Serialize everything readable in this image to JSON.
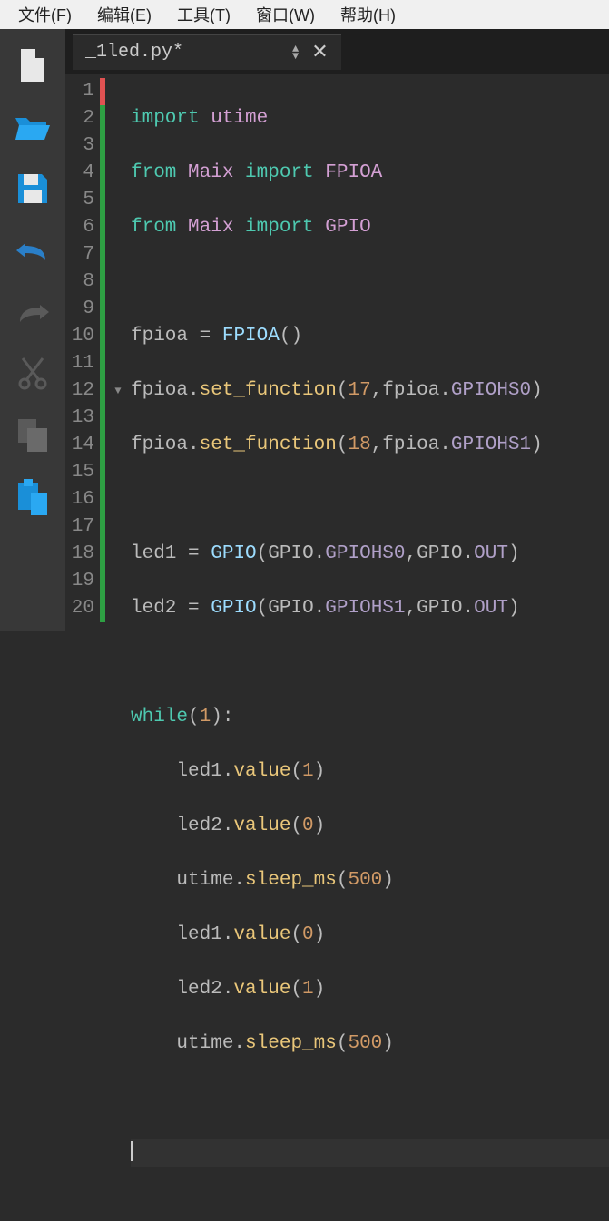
{
  "menubar": {
    "file": "文件(F)",
    "edit": "编辑(E)",
    "tools": "工具(T)",
    "window": "窗口(W)",
    "help": "帮助(H)"
  },
  "tab": {
    "title": "_1led.py*",
    "close": "✕"
  },
  "lines": [
    "1",
    "2",
    "3",
    "4",
    "5",
    "6",
    "7",
    "8",
    "9",
    "10",
    "11",
    "12",
    "13",
    "14",
    "15",
    "16",
    "17",
    "18",
    "19",
    "20"
  ],
  "code": {
    "l1": {
      "a": "import",
      "b": " utime"
    },
    "l2": {
      "a": "from",
      "b": " Maix ",
      "c": "import",
      "d": " FPIOA"
    },
    "l3": {
      "a": "from",
      "b": " Maix ",
      "c": "import",
      "d": " GPIO"
    },
    "l5": {
      "a": "fpioa ",
      "eq": "=",
      "sp": " ",
      "cls": "FPIOA",
      "p": "()"
    },
    "l6": {
      "a": "fpioa.",
      "fn": "set_function",
      "p1": "(",
      "n1": "17",
      "c": ",",
      "b": "fpioa.",
      "prop": "GPIOHS0",
      "p2": ")"
    },
    "l7": {
      "a": "fpioa.",
      "fn": "set_function",
      "p1": "(",
      "n1": "18",
      "c": ",",
      "b": "fpioa.",
      "prop": "GPIOHS1",
      "p2": ")"
    },
    "l9": {
      "a": "led1 ",
      "eq": "=",
      "sp": " ",
      "cls": "GPIO",
      "p1": "(",
      "b": "GPIO.",
      "prop1": "GPIOHS0",
      "c": ",",
      "d": "GPIO.",
      "prop2": "OUT",
      "p2": ")"
    },
    "l10": {
      "a": "led2 ",
      "eq": "=",
      "sp": " ",
      "cls": "GPIO",
      "p1": "(",
      "b": "GPIO.",
      "prop1": "GPIOHS1",
      "c": ",",
      "d": "GPIO.",
      "prop2": "OUT",
      "p2": ")"
    },
    "l12": {
      "kw": "while",
      "p1": "(",
      "n": "1",
      "p2": "):"
    },
    "l13": {
      "a": "    led1.",
      "fn": "value",
      "p1": "(",
      "n": "1",
      "p2": ")"
    },
    "l14": {
      "a": "    led2.",
      "fn": "value",
      "p1": "(",
      "n": "0",
      "p2": ")"
    },
    "l15": {
      "a": "    utime.",
      "fn": "sleep_ms",
      "p1": "(",
      "n": "500",
      "p2": ")"
    },
    "l16": {
      "a": "    led1.",
      "fn": "value",
      "p1": "(",
      "n": "0",
      "p2": ")"
    },
    "l17": {
      "a": "    led2.",
      "fn": "value",
      "p1": "(",
      "n": "1",
      "p2": ")"
    },
    "l18": {
      "a": "    utime.",
      "fn": "sleep_ms",
      "p1": "(",
      "n": "500",
      "p2": ")"
    }
  }
}
